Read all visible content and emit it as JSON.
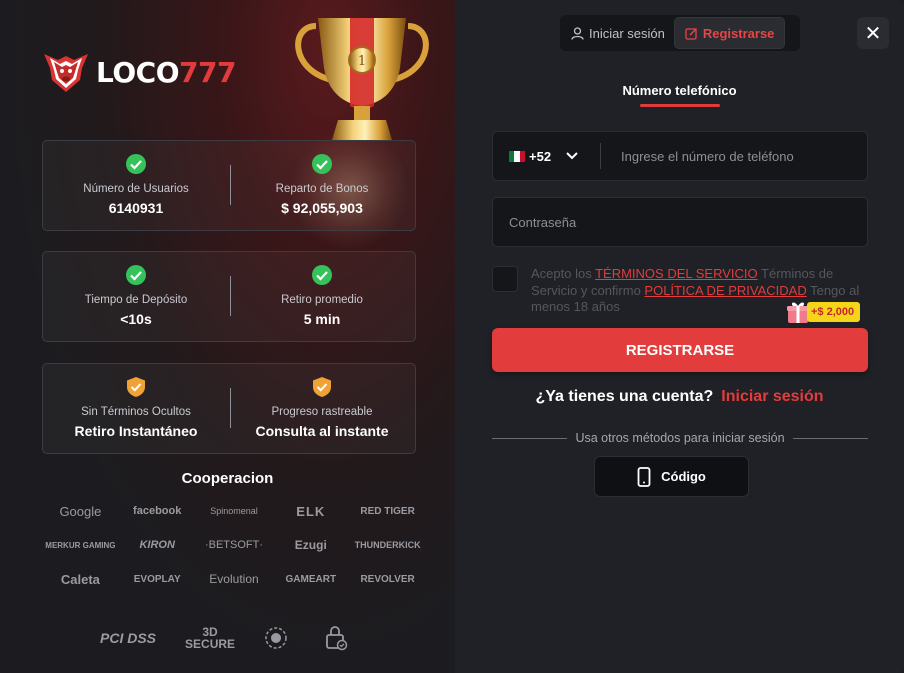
{
  "brand": {
    "name_white": "LOCO",
    "name_red": "777"
  },
  "stats": [
    {
      "icon": "check-circle-icon",
      "label": "Número de Usuarios",
      "value": "6140931"
    },
    {
      "icon": "check-circle-icon",
      "label": "Reparto de Bonos",
      "value": "$ 92,055,903"
    },
    {
      "icon": "check-circle-icon",
      "label": "Tiempo de Depósito",
      "value": "<10s"
    },
    {
      "icon": "check-circle-icon",
      "label": "Retiro promedio",
      "value": "5 min"
    },
    {
      "icon": "shield-check-icon",
      "label": "Sin Términos Ocultos",
      "value": "Retiro Instantáneo"
    },
    {
      "icon": "shield-check-icon",
      "label": "Progreso rastreable",
      "value": "Consulta al instante"
    }
  ],
  "cooperation": {
    "title": "Cooperacion",
    "partners": [
      "Google",
      "facebook",
      "Spinomenal",
      "ELK",
      "RED TIGER",
      "MERKUR GAMING",
      "KIRON",
      "·BETSOFT·",
      "Ezugi",
      "THUNDERKICK",
      "Caleta",
      "EVOPLAY",
      "Evolution",
      "GAMEART",
      "REVOLVER"
    ]
  },
  "certs": [
    "PCI DSS",
    "3D SECURE"
  ],
  "auth": {
    "login_tab": "Iniciar sesión",
    "register_tab": "Registrarse",
    "close_icon": "✕",
    "subtab": "Número telefónico",
    "country_code": "+52",
    "phone_placeholder": "Ingrese el número de teléfono",
    "password_placeholder": "Contraseña",
    "terms_1": "Acepto los ",
    "terms_link_1": "TÉRMINOS DEL SERVICIO",
    "terms_2": " Términos de Servicio y confirmo ",
    "terms_link_2": "POLÍTICA DE PRIVACIDAD",
    "terms_3": " Tengo al menos 18 años",
    "bonus_badge": "+$ 2,000",
    "register_button": "REGISTRARSE",
    "have_account": "¿Ya tienes una cuenta?",
    "login_link": "Iniciar sesión",
    "other_methods": "Usa otros métodos para iniciar sesión",
    "code_button": "Código"
  },
  "colors": {
    "accent": "#e23c3c",
    "check_green": "#35c25a",
    "shield_orange": "#f0a236",
    "badge_yellow": "#f5d51a"
  }
}
